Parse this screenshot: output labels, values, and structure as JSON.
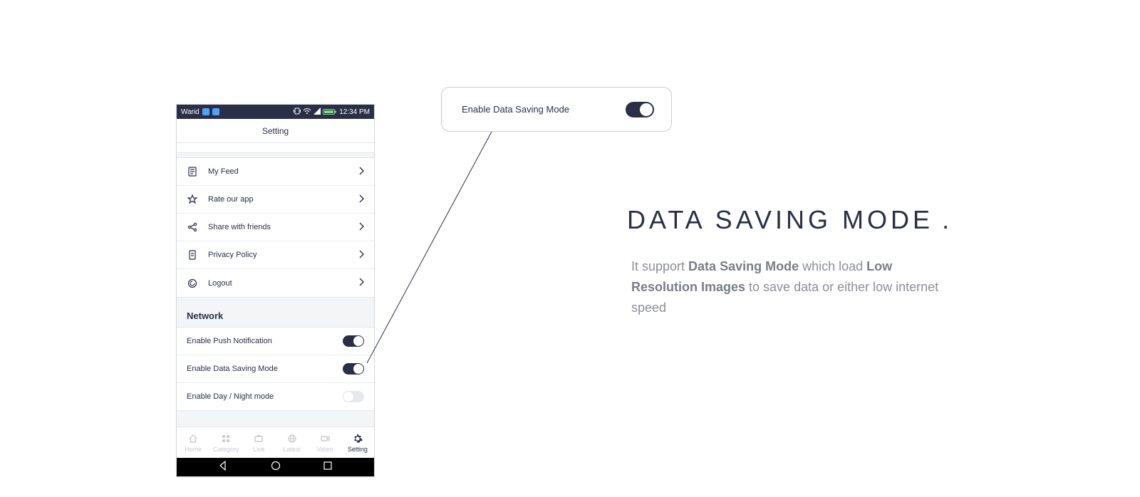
{
  "statusbar": {
    "carrier": "Warid",
    "time": "12:34 PM"
  },
  "app": {
    "header_title": "Setting"
  },
  "menu": {
    "items": [
      {
        "label": "My Feed"
      },
      {
        "label": "Rate our app"
      },
      {
        "label": "Share with friends"
      },
      {
        "label": "Privacy Policy"
      },
      {
        "label": "Logout"
      }
    ]
  },
  "network": {
    "section_title": "Network",
    "toggles": [
      {
        "label": "Enable Push Notification",
        "on": true
      },
      {
        "label": "Enable Data Saving Mode",
        "on": true
      },
      {
        "label": "Enable Day / Night mode",
        "on": false
      }
    ]
  },
  "bottomnav": {
    "items": [
      {
        "label": "Home"
      },
      {
        "label": "Category"
      },
      {
        "label": "Live"
      },
      {
        "label": "Latest"
      },
      {
        "label": "Video"
      },
      {
        "label": "Setting"
      }
    ],
    "active_index": 5
  },
  "callout": {
    "label": "Enable Data Saving Mode"
  },
  "headline": {
    "text": "DATA SAVING MODE",
    "dot": "."
  },
  "description": {
    "part1": "It support ",
    "bold1": "Data Saving Mode",
    "part2": " which load ",
    "bold2": "Low Resolution Images",
    "part3": " to save data or either low internet speed"
  }
}
